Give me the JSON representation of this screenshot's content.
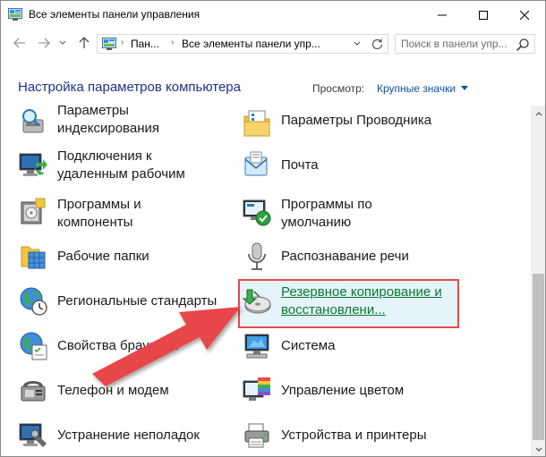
{
  "window": {
    "title": "Все элементы панели управления"
  },
  "address": {
    "crumbs": [
      "Пан...",
      "Все элементы панели упр..."
    ],
    "search_placeholder": "Поиск в панели упр..."
  },
  "header": {
    "title": "Настройка параметров компьютера",
    "view_label": "Просмотр:",
    "view_value": "Крупные значки"
  },
  "items": [
    {
      "icon": "indexing-options-icon",
      "label_lines": [
        "Параметры",
        "индексирования"
      ]
    },
    {
      "icon": "file-explorer-options-icon",
      "label_lines": [
        "Параметры Проводника"
      ]
    },
    {
      "icon": "remote-desktop-icon",
      "label_lines": [
        "Подключения к",
        "удаленным рабочим"
      ]
    },
    {
      "icon": "mail-icon",
      "label_lines": [
        "Почта"
      ]
    },
    {
      "icon": "programs-and-features-icon",
      "label_lines": [
        "Программы и",
        "компоненты"
      ]
    },
    {
      "icon": "default-programs-icon",
      "label_lines": [
        "Программы по",
        "умолчанию"
      ]
    },
    {
      "icon": "work-folders-icon",
      "label_lines": [
        "Рабочие папки"
      ]
    },
    {
      "icon": "speech-recognition-icon",
      "label_lines": [
        "Распознавание речи"
      ]
    },
    {
      "icon": "region-icon",
      "label_lines": [
        "Региональные стандарты"
      ]
    },
    {
      "icon": "backup-restore-icon",
      "label_lines": [
        "Резервное копирование и",
        "восстановлени..."
      ]
    },
    {
      "icon": "browser-properties-icon",
      "label_lines": [
        "Свойства браузера"
      ]
    },
    {
      "icon": "system-icon",
      "label_lines": [
        "Система"
      ]
    },
    {
      "icon": "phone-modem-icon",
      "label_lines": [
        "Телефон и модем"
      ]
    },
    {
      "icon": "color-management-icon",
      "label_lines": [
        "Управление цветом"
      ]
    },
    {
      "icon": "troubleshooting-icon",
      "label_lines": [
        "Устранение неполадок"
      ]
    },
    {
      "icon": "devices-printers-icon",
      "label_lines": [
        "Устройства и принтеры"
      ]
    }
  ],
  "colors": {
    "title_blue": "#1e3287",
    "link_blue": "#0a52a8",
    "highlight_red": "#e8474a",
    "arrow_red": "#e8474a"
  }
}
